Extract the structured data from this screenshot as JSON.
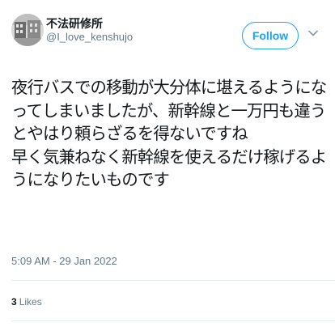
{
  "author": {
    "display_name": "不法研修所",
    "handle": "@I_love_kenshujo"
  },
  "follow_button": {
    "label": "Follow"
  },
  "tweet": {
    "lines": [
      "夜行バスでの移動が大分体に堪えるようにな",
      "ってしまいましたが、新幹線と一万円も違う",
      "とやはり頼らざるを得ないですね",
      "早く気兼ねなく新幹線を使えるだけ稼げるよ",
      "うになりたいものです"
    ],
    "timestamp": "5:09 AM - 29 Jan 2022"
  },
  "stats": {
    "likes_count": "3",
    "likes_label": "Likes"
  },
  "colors": {
    "accent": "#1da1f2",
    "secondary_text": "#657786",
    "divider": "#e6ecf0"
  },
  "icons": {
    "more": "chevron-down-icon"
  }
}
